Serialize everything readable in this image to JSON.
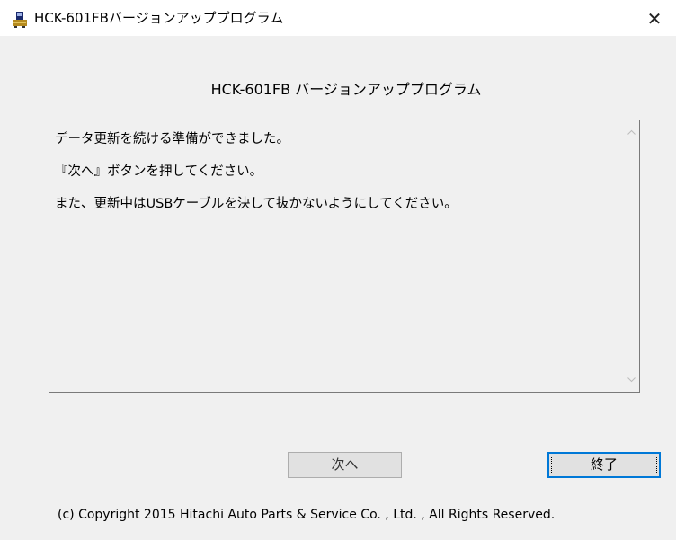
{
  "window": {
    "title": "HCK-601FBバージョンアッププログラム",
    "icon": "app-icon",
    "close_label": "✕"
  },
  "main": {
    "heading": "HCK-601FB バージョンアッププログラム",
    "messages": [
      "データ更新を続ける準備ができました。",
      "『次へ』ボタンを押してください。",
      "また、更新中はUSBケーブルを決して抜かないようにしてください。"
    ]
  },
  "buttons": {
    "next_label": "次へ",
    "exit_label": "終了"
  },
  "footer": {
    "copyright": "(c) Copyright 2015  Hitachi Auto Parts & Service Co. , Ltd. , All Rights Reserved."
  },
  "colors": {
    "window_bg": "#f0f0f0",
    "focus_blue": "#0078d7"
  }
}
